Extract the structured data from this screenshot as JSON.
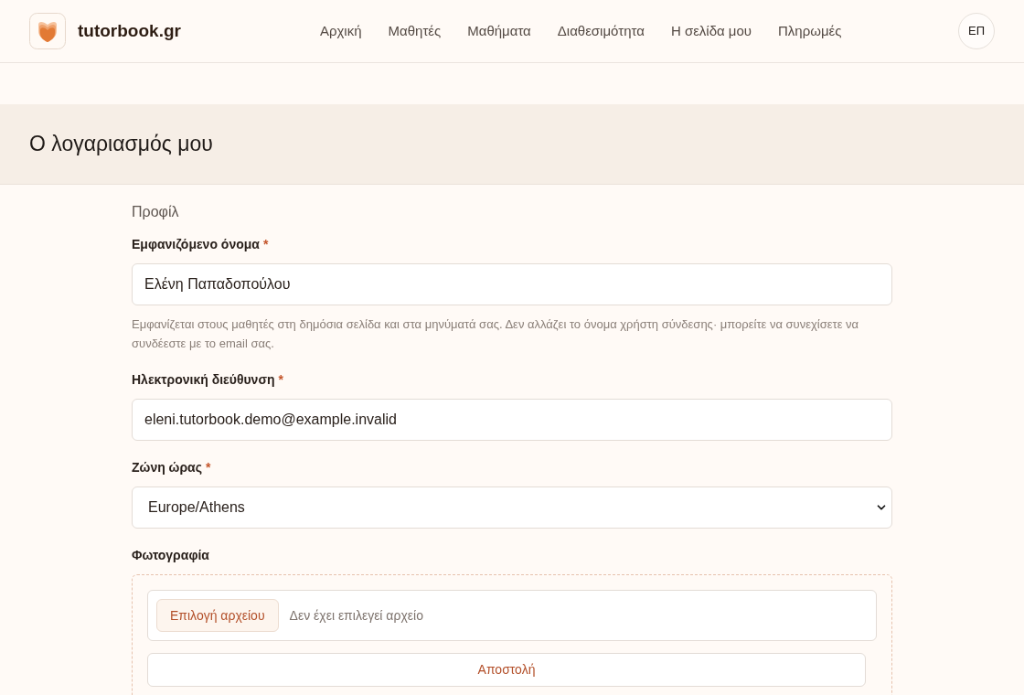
{
  "header": {
    "brand": "tutorbook.gr",
    "nav": [
      "Αρχική",
      "Μαθητές",
      "Μαθήματα",
      "Διαθεσιμότητα",
      "Η σελίδα μου",
      "Πληρωμές"
    ],
    "avatar_initials": "ΕΠ"
  },
  "page": {
    "title": "Ο λογαριασμός μου"
  },
  "section": {
    "title": "Προφίλ",
    "fields": [
      {
        "kind": "text",
        "label": "Εμφανιζόμενο όνομα",
        "required_mark": "*",
        "value": "Ελένη Παπαδοπούλου",
        "help": "Εμφανίζεται στους μαθητές στη δημόσια σελίδα και στα μηνύματά σας. Δεν αλλάζει το όνομα χρήστη σύνδεσης· μπορείτε να συνεχίσετε να συνδέεστε με το email σας."
      },
      {
        "kind": "email",
        "label": "Ηλεκτρονική διεύθυνση",
        "required_mark": "*",
        "value": "eleni.tutorbook.demo@example.invalid"
      },
      {
        "kind": "select",
        "label": "Ζώνη ώρας",
        "required_mark": "*",
        "value": "Europe/Athens"
      },
      {
        "kind": "file",
        "label": "Φωτογραφία",
        "choose_button": "Επιλογή αρχείου",
        "status": "Δεν έχει επιλεγεί αρχείο",
        "submit_button": "Αποστολή"
      }
    ]
  }
}
